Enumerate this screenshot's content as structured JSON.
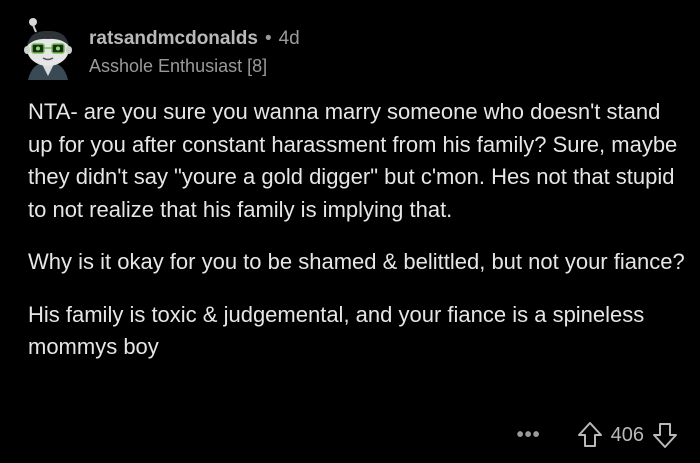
{
  "comment": {
    "author": "ratsandmcdonalds",
    "separator": "•",
    "age": "4d",
    "flair": "Asshole Enthusiast [8]",
    "paragraphs": [
      "NTA- are you sure you wanna marry someone who doesn't stand up for you after constant harassment from his family? Sure, maybe they didn't say \"youre a gold digger\" but c'mon. Hes not that stupid to not realize that his family is implying that.",
      "Why is it okay for you to be shamed & belittled, but not your fiance?",
      "His family is toxic & judgemental, and your fiance is a spineless mommys boy"
    ],
    "actions": {
      "more": "•••",
      "score": "406"
    }
  },
  "icons": {
    "avatar": "snoo-avatar-icon",
    "upvote": "upvote-arrow-icon",
    "downvote": "downvote-arrow-icon"
  },
  "colors": {
    "background": "#000000",
    "text": "#e6e6e6",
    "muted": "#9a9a9a"
  }
}
